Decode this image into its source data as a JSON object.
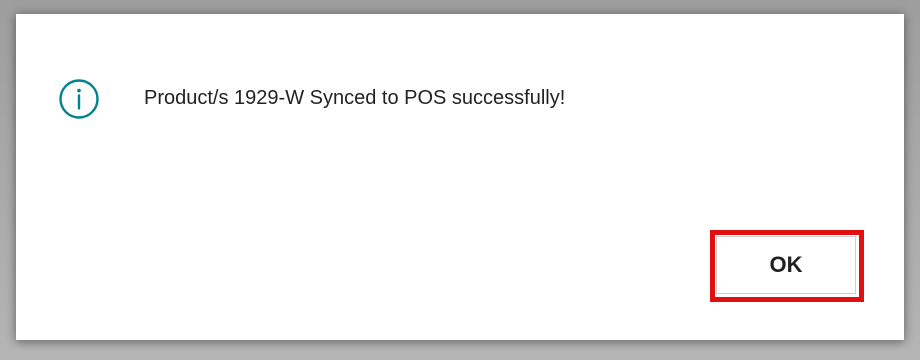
{
  "dialog": {
    "icon": "info-circle-icon",
    "message": "Product/s 1929-W Synced to POS successfully!",
    "ok_label": "OK",
    "colors": {
      "icon": "#00838f",
      "highlight": "#e00f12",
      "text": "#222222"
    }
  }
}
